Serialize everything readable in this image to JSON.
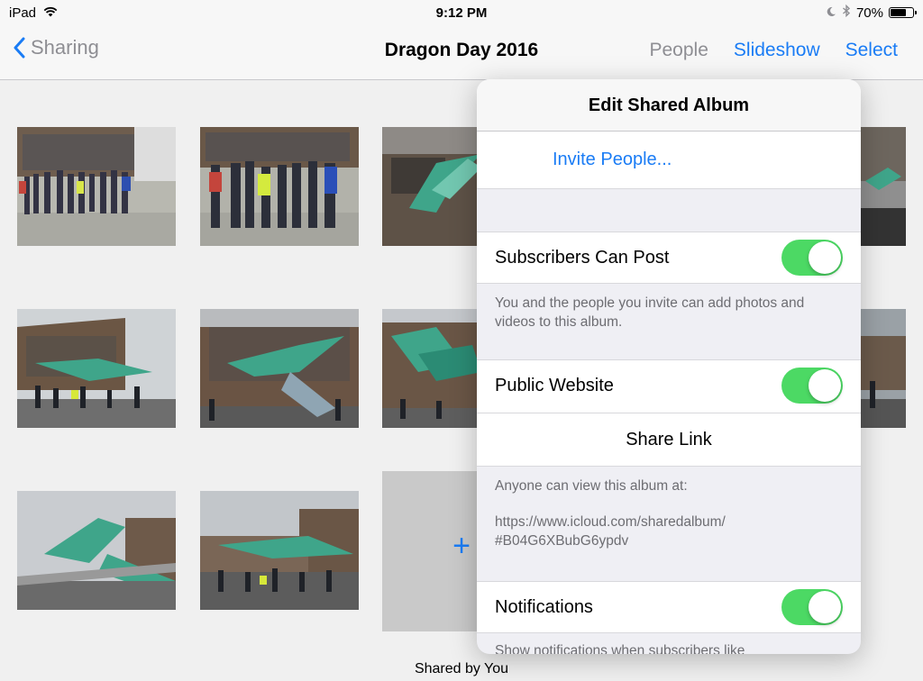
{
  "status_bar": {
    "device": "iPad",
    "time": "9:12 PM",
    "battery": "70%",
    "battery_level": 0.7
  },
  "nav": {
    "back_label": "Sharing",
    "title": "Dragon Day 2016",
    "people": "People",
    "slideshow": "Slideshow",
    "select": "Select"
  },
  "album": {
    "add_label": "+",
    "footer": "Shared by You"
  },
  "popover": {
    "title": "Edit Shared Album",
    "invite": "Invite People...",
    "subscribers_can_post": {
      "label": "Subscribers Can Post",
      "on": true
    },
    "subscribers_note": "You and the people you invite can add photos and videos to this album.",
    "public_website": {
      "label": "Public Website",
      "on": true
    },
    "share_link": "Share Link",
    "public_note": "Anyone can view this album at:",
    "url_line1": "https://www.icloud.com/sharedalbum/",
    "url_line2": "#B04G6XBubG6ypdv",
    "notifications": {
      "label": "Notifications",
      "on": true
    },
    "notifications_note": "Show notifications when subscribers like"
  },
  "colors": {
    "accent": "#1a7cf5",
    "toggle_on": "#4cd964",
    "secondary_text": "#8e8e93"
  }
}
